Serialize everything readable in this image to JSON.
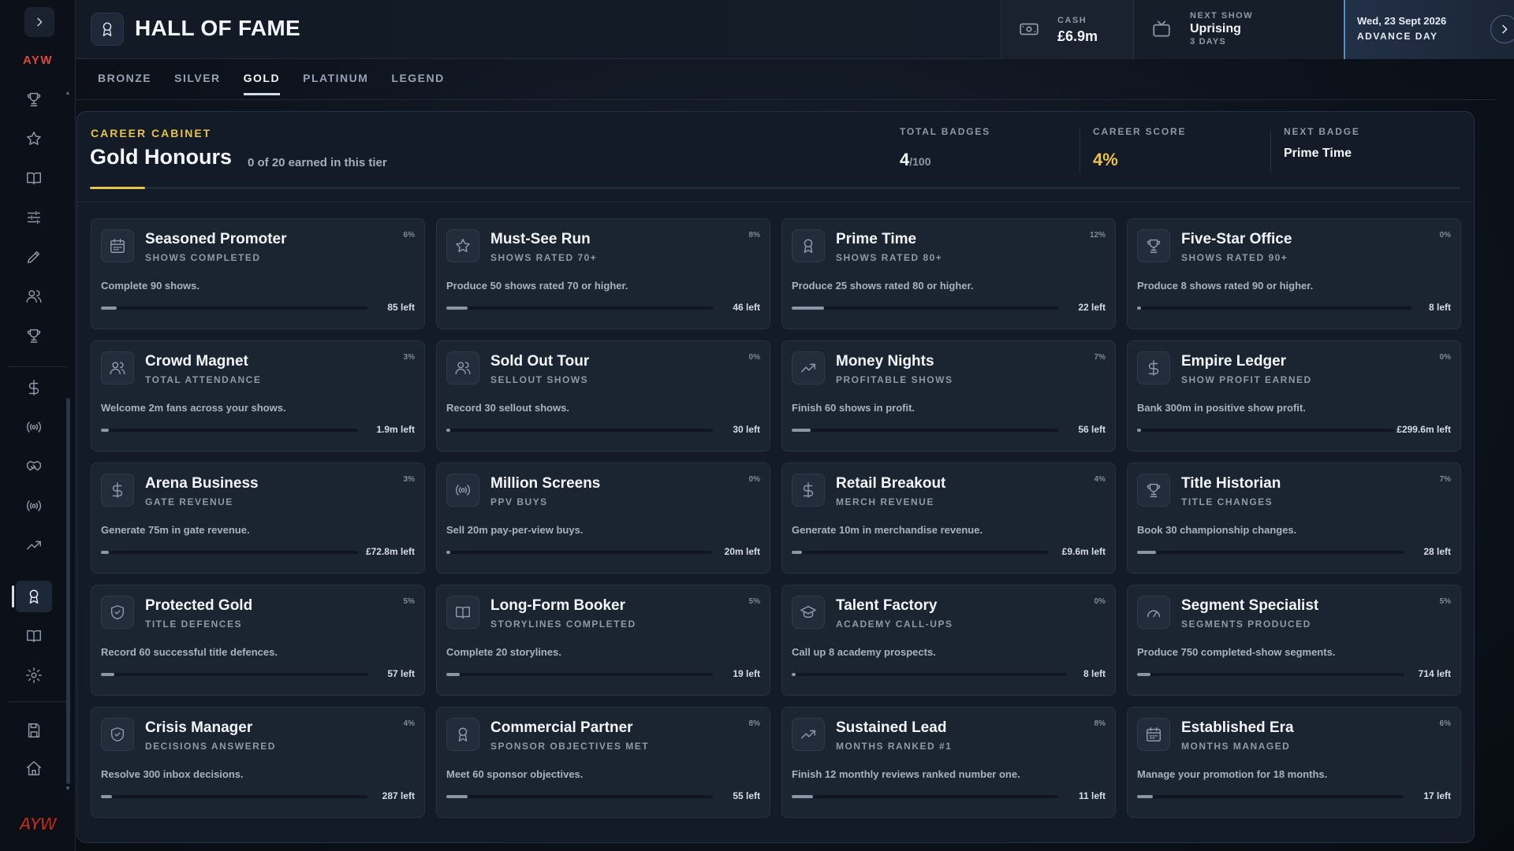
{
  "brand": "AYW",
  "header": {
    "title": "HALL OF FAME",
    "cash": {
      "label": "CASH",
      "value": "£6.9m"
    },
    "next_show": {
      "label": "NEXT SHOW",
      "name": "Uprising",
      "days": "3 DAYS"
    },
    "advance": {
      "date": "Wed, 23 Sept 2026",
      "label": "ADVANCE DAY"
    }
  },
  "tabs": [
    {
      "label": "BRONZE",
      "active": false
    },
    {
      "label": "SILVER",
      "active": false
    },
    {
      "label": "GOLD",
      "active": true
    },
    {
      "label": "PLATINUM",
      "active": false
    },
    {
      "label": "LEGEND",
      "active": false
    }
  ],
  "cabinet": {
    "kicker": "CAREER CABINET",
    "title": "Gold Honours",
    "subtitle": "0 of 20 earned in this tier",
    "progress": 0.04,
    "total_badges": {
      "label": "TOTAL BADGES",
      "value": "4",
      "suffix": "/100"
    },
    "career_score": {
      "label": "CAREER SCORE",
      "value": "4%"
    },
    "next_badge": {
      "label": "NEXT BADGE",
      "value": "Prime Time"
    }
  },
  "sidebar": {
    "items": [
      {
        "icon": "trophy-icon",
        "active": false
      },
      {
        "icon": "star-icon",
        "active": false
      },
      {
        "icon": "book-icon",
        "active": false
      },
      {
        "icon": "sliders-icon",
        "active": false
      },
      {
        "icon": "pencil-icon",
        "active": false
      },
      {
        "icon": "users-icon",
        "active": false
      },
      {
        "icon": "trophy-icon",
        "active": false
      },
      {
        "icon": "dollar-icon",
        "active": false
      },
      {
        "icon": "broadcast-icon",
        "active": false
      },
      {
        "icon": "handshake-icon",
        "active": false
      },
      {
        "icon": "broadcast-icon",
        "active": false
      },
      {
        "icon": "trend-icon",
        "active": false
      },
      {
        "icon": "award-icon",
        "active": true
      },
      {
        "icon": "book-icon",
        "active": false
      },
      {
        "icon": "gear-icon",
        "active": false
      },
      {
        "icon": "save-icon",
        "active": false
      },
      {
        "icon": "home-icon",
        "active": false
      }
    ]
  },
  "badges": [
    {
      "icon": "calendar-icon",
      "title": "Seasoned Promoter",
      "subtitle": "SHOWS COMPLETED",
      "percent": "6%",
      "progress": 0.06,
      "desc": "Complete 90 shows.",
      "left": "85 left"
    },
    {
      "icon": "star-icon",
      "title": "Must-See Run",
      "subtitle": "SHOWS RATED 70+",
      "percent": "8%",
      "progress": 0.08,
      "desc": "Produce 50 shows rated 70 or higher.",
      "left": "46 left"
    },
    {
      "icon": "award-icon",
      "title": "Prime Time",
      "subtitle": "SHOWS RATED 80+",
      "percent": "12%",
      "progress": 0.12,
      "desc": "Produce 25 shows rated 80 or higher.",
      "left": "22 left"
    },
    {
      "icon": "trophy-icon",
      "title": "Five-Star Office",
      "subtitle": "SHOWS RATED 90+",
      "percent": "0%",
      "progress": 0,
      "desc": "Produce 8 shows rated 90 or higher.",
      "left": "8 left"
    },
    {
      "icon": "users-icon",
      "title": "Crowd Magnet",
      "subtitle": "TOTAL ATTENDANCE",
      "percent": "3%",
      "progress": 0.03,
      "desc": "Welcome 2m fans across your shows.",
      "left": "1.9m left"
    },
    {
      "icon": "users-icon",
      "title": "Sold Out Tour",
      "subtitle": "SELLOUT SHOWS",
      "percent": "0%",
      "progress": 0,
      "desc": "Record 30 sellout shows.",
      "left": "30 left"
    },
    {
      "icon": "trend-icon",
      "title": "Money Nights",
      "subtitle": "PROFITABLE SHOWS",
      "percent": "7%",
      "progress": 0.07,
      "desc": "Finish 60 shows in profit.",
      "left": "56 left"
    },
    {
      "icon": "dollar-icon",
      "title": "Empire Ledger",
      "subtitle": "SHOW PROFIT EARNED",
      "percent": "0%",
      "progress": 0,
      "desc": "Bank 300m in positive show profit.",
      "left": "£299.6m left"
    },
    {
      "icon": "dollar-icon",
      "title": "Arena Business",
      "subtitle": "GATE REVENUE",
      "percent": "3%",
      "progress": 0.03,
      "desc": "Generate 75m in gate revenue.",
      "left": "£72.8m left"
    },
    {
      "icon": "broadcast-icon",
      "title": "Million Screens",
      "subtitle": "PPV BUYS",
      "percent": "0%",
      "progress": 0,
      "desc": "Sell 20m pay-per-view buys.",
      "left": "20m left"
    },
    {
      "icon": "dollar-icon",
      "title": "Retail Breakout",
      "subtitle": "MERCH REVENUE",
      "percent": "4%",
      "progress": 0.04,
      "desc": "Generate 10m in merchandise revenue.",
      "left": "£9.6m left"
    },
    {
      "icon": "trophy-icon",
      "title": "Title Historian",
      "subtitle": "TITLE CHANGES",
      "percent": "7%",
      "progress": 0.07,
      "desc": "Book 30 championship changes.",
      "left": "28 left"
    },
    {
      "icon": "shield-icon",
      "title": "Protected Gold",
      "subtitle": "TITLE DEFENCES",
      "percent": "5%",
      "progress": 0.05,
      "desc": "Record 60 successful title defences.",
      "left": "57 left"
    },
    {
      "icon": "book-icon",
      "title": "Long-Form Booker",
      "subtitle": "STORYLINES COMPLETED",
      "percent": "5%",
      "progress": 0.05,
      "desc": "Complete 20 storylines.",
      "left": "19 left"
    },
    {
      "icon": "graduation-cap-icon",
      "title": "Talent Factory",
      "subtitle": "ACADEMY CALL-UPS",
      "percent": "0%",
      "progress": 0,
      "desc": "Call up 8 academy prospects.",
      "left": "8 left"
    },
    {
      "icon": "gauge-icon",
      "title": "Segment Specialist",
      "subtitle": "SEGMENTS PRODUCED",
      "percent": "5%",
      "progress": 0.05,
      "desc": "Produce 750 completed-show segments.",
      "left": "714 left"
    },
    {
      "icon": "shield-icon",
      "title": "Crisis Manager",
      "subtitle": "DECISIONS ANSWERED",
      "percent": "4%",
      "progress": 0.04,
      "desc": "Resolve 300 inbox decisions.",
      "left": "287 left"
    },
    {
      "icon": "award-icon",
      "title": "Commercial Partner",
      "subtitle": "SPONSOR OBJECTIVES MET",
      "percent": "8%",
      "progress": 0.08,
      "desc": "Meet 60 sponsor objectives.",
      "left": "55 left"
    },
    {
      "icon": "trend-icon",
      "title": "Sustained Lead",
      "subtitle": "MONTHS RANKED #1",
      "percent": "8%",
      "progress": 0.08,
      "desc": "Finish 12 monthly reviews ranked number one.",
      "left": "11 left"
    },
    {
      "icon": "calendar-icon",
      "title": "Established Era",
      "subtitle": "MONTHS MANAGED",
      "percent": "6%",
      "progress": 0.06,
      "desc": "Manage your promotion for 18 months.",
      "left": "17 left"
    }
  ],
  "colors": {
    "accent_gold": "#e9c24a",
    "brand_red": "#e0473a",
    "advance_border": "#5b8cc4"
  }
}
